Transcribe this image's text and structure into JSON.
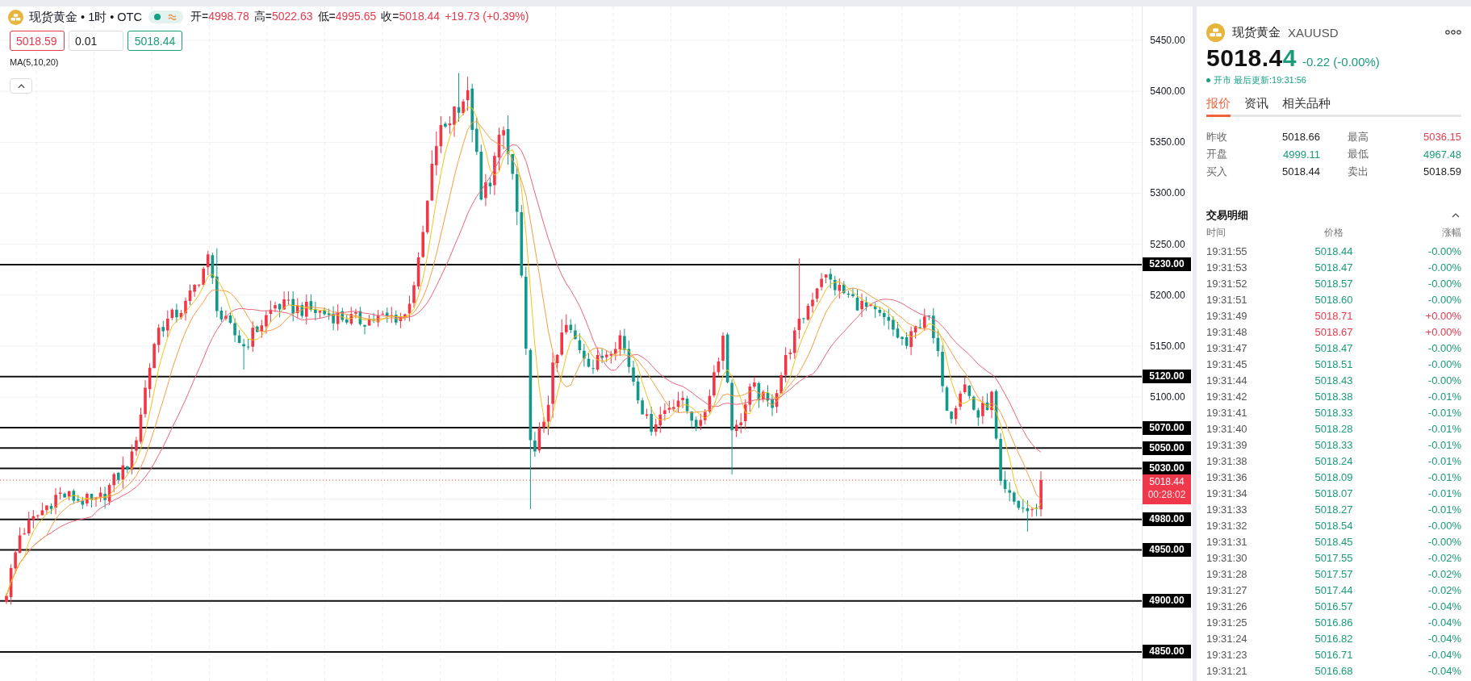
{
  "chart_header": {
    "title": "现货黄金 • 1时 • OTC",
    "ohlc": {
      "rising": true,
      "fields": [
        {
          "label": "开=",
          "value": "4998.78"
        },
        {
          "label": "高=",
          "value": "5022.63"
        },
        {
          "label": "低=",
          "value": "4995.65"
        },
        {
          "label": "收=",
          "value": "5018.44"
        }
      ],
      "change": "+19.73 (+0.39%)"
    }
  },
  "order_panel": {
    "sell_price": "5018.59",
    "quantity": "0.01",
    "buy_price": "5018.44"
  },
  "indicator": {
    "label": "MA(5,10,20)"
  },
  "price_axis": {
    "ticks": [
      "5450.00",
      "5400.00",
      "5350.00",
      "5300.00",
      "5250.00",
      "5200.00",
      "5150.00",
      "5100.00"
    ]
  },
  "price_lines": [
    "5230.00",
    "5120.00",
    "5070.00",
    "5050.00",
    "5030.00",
    "4980.00",
    "4950.00",
    "4900.00",
    "4850.00"
  ],
  "last_price": {
    "price": "5018.44",
    "countdown": "00:28:02"
  },
  "quote": {
    "name": "现货黄金",
    "symbol": "XAUUSD",
    "price_steady": "5018.4",
    "price_changed": "4",
    "rising": false,
    "change": "-0.22 (-0.00%)",
    "status": "开市 最后更新:19:31:56"
  },
  "tabs": [
    {
      "label": "报价",
      "selected": true
    },
    {
      "label": "资讯",
      "selected": false
    },
    {
      "label": "相关品种",
      "selected": false
    }
  ],
  "stats": [
    {
      "label": "昨收",
      "value": "5018.66",
      "color": "#222222"
    },
    {
      "label": "最高",
      "value": "5036.15",
      "color": "#e8394c"
    },
    {
      "label": "开盘",
      "value": "4999.11",
      "color": "#1a9b7c"
    },
    {
      "label": "最低",
      "value": "4967.48",
      "color": "#1a9b7c"
    },
    {
      "label": "买入",
      "value": "5018.44",
      "color": "#222222"
    },
    {
      "label": "卖出",
      "value": "5018.59",
      "color": "#222222"
    }
  ],
  "trades": {
    "title": "交易明细",
    "columns": [
      "时间",
      "价格",
      "涨幅"
    ],
    "rows": [
      {
        "time": "19:31:55",
        "price": "5018.44",
        "change": "-0.00%",
        "color": "#1a9b7c"
      },
      {
        "time": "19:31:53",
        "price": "5018.47",
        "change": "-0.00%",
        "color": "#1a9b7c"
      },
      {
        "time": "19:31:52",
        "price": "5018.57",
        "change": "-0.00%",
        "color": "#1a9b7c"
      },
      {
        "time": "19:31:51",
        "price": "5018.60",
        "change": "-0.00%",
        "color": "#1a9b7c"
      },
      {
        "time": "19:31:49",
        "price": "5018.71",
        "change": "+0.00%",
        "color": "#e8394c"
      },
      {
        "time": "19:31:48",
        "price": "5018.67",
        "change": "+0.00%",
        "color": "#e8394c"
      },
      {
        "time": "19:31:47",
        "price": "5018.47",
        "change": "-0.00%",
        "color": "#1a9b7c"
      },
      {
        "time": "19:31:45",
        "price": "5018.51",
        "change": "-0.00%",
        "color": "#1a9b7c"
      },
      {
        "time": "19:31:44",
        "price": "5018.43",
        "change": "-0.00%",
        "color": "#1a9b7c"
      },
      {
        "time": "19:31:42",
        "price": "5018.38",
        "change": "-0.01%",
        "color": "#1a9b7c"
      },
      {
        "time": "19:31:41",
        "price": "5018.33",
        "change": "-0.01%",
        "color": "#1a9b7c"
      },
      {
        "time": "19:31:40",
        "price": "5018.28",
        "change": "-0.01%",
        "color": "#1a9b7c"
      },
      {
        "time": "19:31:39",
        "price": "5018.33",
        "change": "-0.01%",
        "color": "#1a9b7c"
      },
      {
        "time": "19:31:38",
        "price": "5018.24",
        "change": "-0.01%",
        "color": "#1a9b7c"
      },
      {
        "time": "19:31:36",
        "price": "5018.09",
        "change": "-0.01%",
        "color": "#1a9b7c"
      },
      {
        "time": "19:31:34",
        "price": "5018.07",
        "change": "-0.01%",
        "color": "#1a9b7c"
      },
      {
        "time": "19:31:33",
        "price": "5018.27",
        "change": "-0.01%",
        "color": "#1a9b7c"
      },
      {
        "time": "19:31:32",
        "price": "5018.54",
        "change": "-0.00%",
        "color": "#1a9b7c"
      },
      {
        "time": "19:31:31",
        "price": "5018.45",
        "change": "-0.00%",
        "color": "#1a9b7c"
      },
      {
        "time": "19:31:30",
        "price": "5017.55",
        "change": "-0.02%",
        "color": "#1a9b7c"
      },
      {
        "time": "19:31:28",
        "price": "5017.57",
        "change": "-0.02%",
        "color": "#1a9b7c"
      },
      {
        "time": "19:31:27",
        "price": "5017.44",
        "change": "-0.02%",
        "color": "#1a9b7c"
      },
      {
        "time": "19:31:26",
        "price": "5016.57",
        "change": "-0.04%",
        "color": "#1a9b7c"
      },
      {
        "time": "19:31:25",
        "price": "5016.86",
        "change": "-0.04%",
        "color": "#1a9b7c"
      },
      {
        "time": "19:31:24",
        "price": "5016.82",
        "change": "-0.04%",
        "color": "#1a9b7c"
      },
      {
        "time": "19:31:23",
        "price": "5016.71",
        "change": "-0.04%",
        "color": "#1a9b7c"
      },
      {
        "time": "19:31:21",
        "price": "5016.68",
        "change": "-0.04%",
        "color": "#1a9b7c"
      }
    ]
  }
}
